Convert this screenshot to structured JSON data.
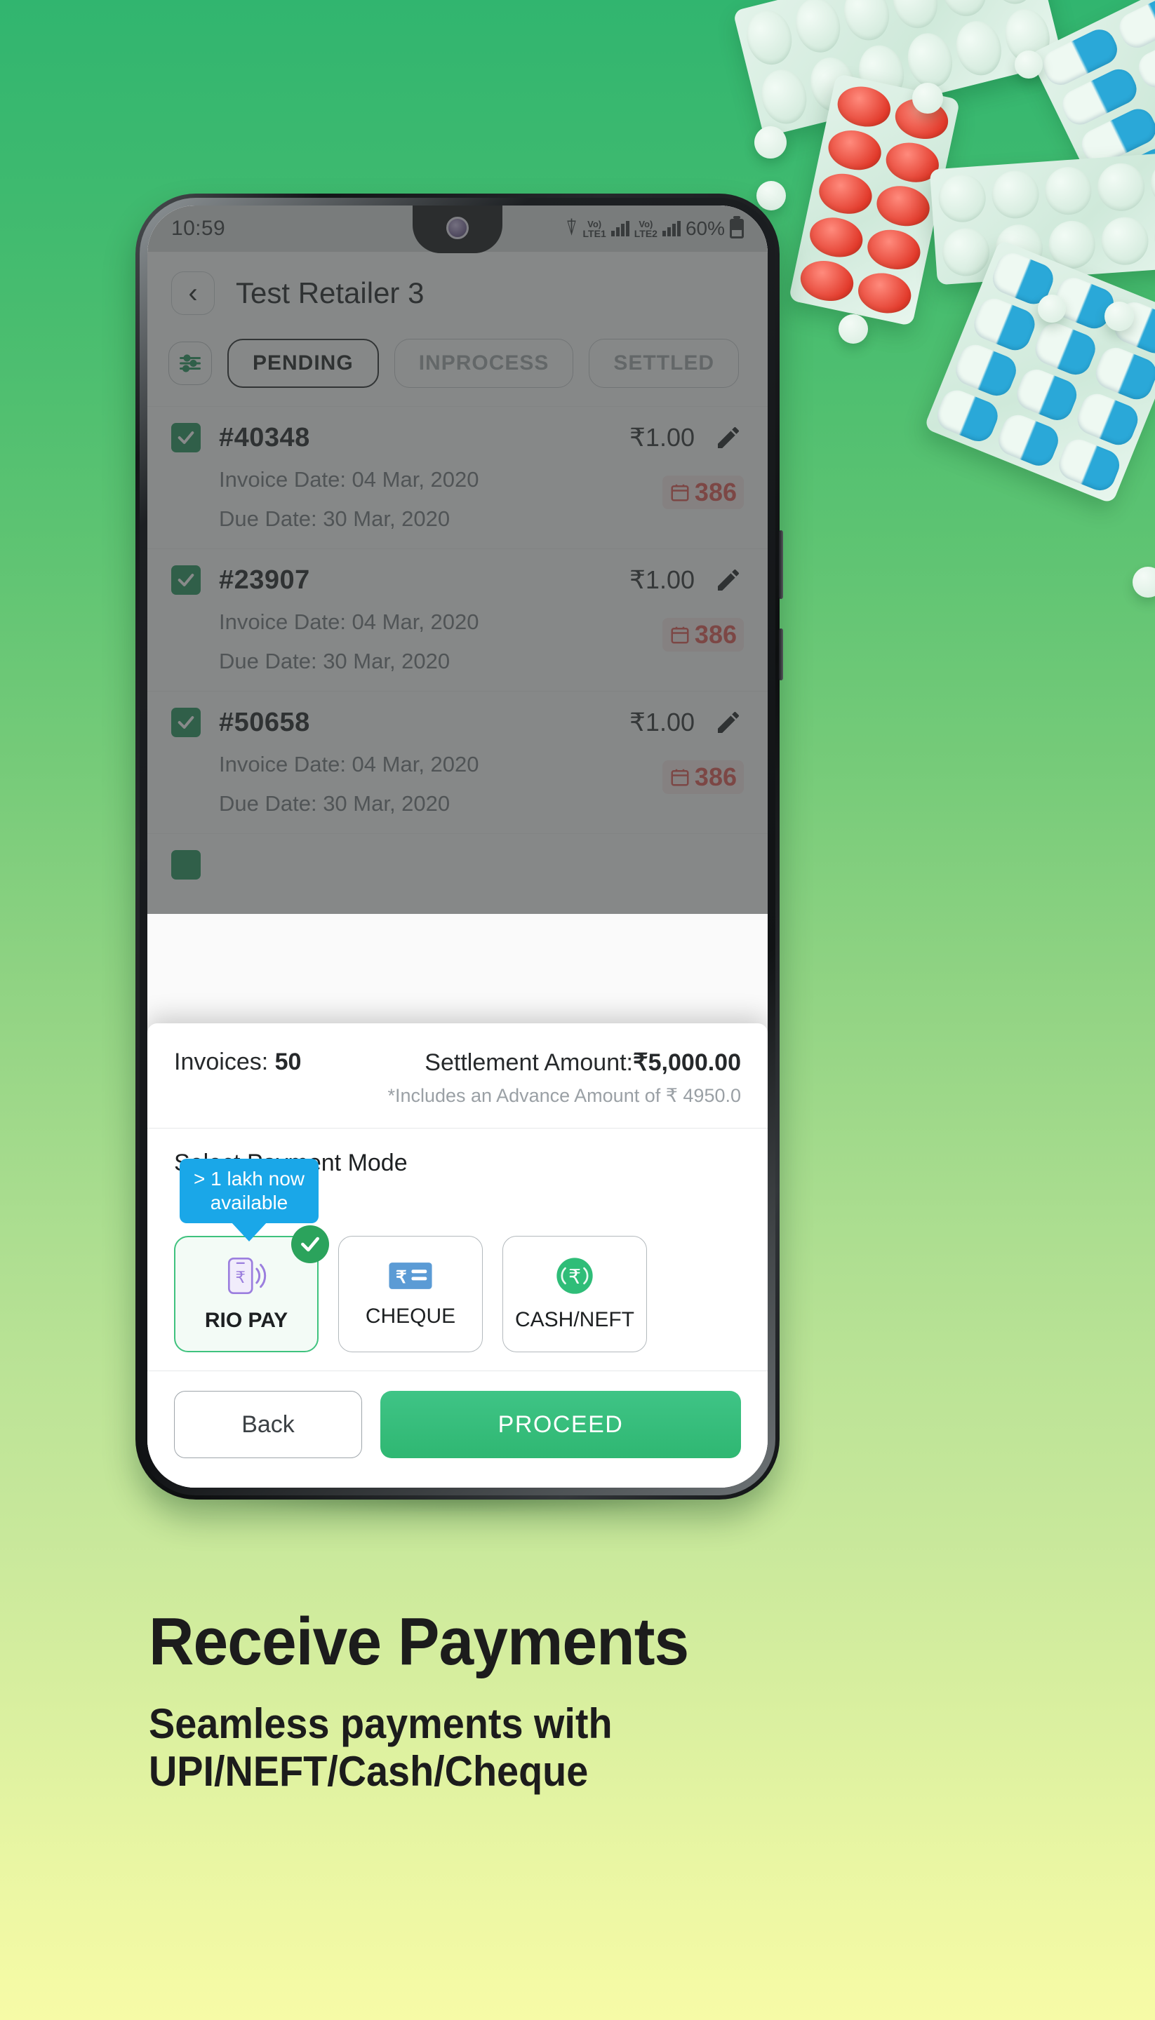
{
  "background": {
    "gradient_top": "#31b56f",
    "gradient_bottom": "#f7fba6",
    "motif": "pill-blister-packs"
  },
  "phone": {
    "statusbar": {
      "time": "10:59",
      "wifi_icon": "wifi-icon",
      "sim1_label": "Vo)",
      "sim1_sub": "LTE1",
      "sim2_label": "Vo)",
      "sim2_sub": "LTE2",
      "battery_percent": "60%",
      "battery_icon": "battery-icon"
    },
    "appbar": {
      "back_icon": "chevron-left-icon",
      "title": "Test Retailer 3"
    },
    "tabs": {
      "filter_icon": "filter-sliders-icon",
      "items": [
        {
          "label": "PENDING",
          "active": true
        },
        {
          "label": "INPROCESS",
          "active": false
        },
        {
          "label": "SETTLED",
          "active": false
        }
      ]
    },
    "invoices": [
      {
        "id": "#40348",
        "amount": "₹1.00",
        "invoice_date": "Invoice Date: 04 Mar, 2020",
        "due_date": "Due Date: 30 Mar, 2020",
        "days_overdue": "386",
        "selected": true
      },
      {
        "id": "#23907",
        "amount": "₹1.00",
        "invoice_date": "Invoice Date: 04 Mar, 2020",
        "due_date": "Due Date: 30 Mar, 2020",
        "days_overdue": "386",
        "selected": true
      },
      {
        "id": "#50658",
        "amount": "₹1.00",
        "invoice_date": "Invoice Date: 04 Mar, 2020",
        "due_date": "Due Date: 30 Mar, 2020",
        "days_overdue": "386",
        "selected": true
      }
    ],
    "sheet": {
      "invoices_label": "Invoices:",
      "invoices_count": "50",
      "settlement_label": "Settlement Amount:",
      "settlement_amount": "₹5,000.00",
      "advance_note": "*Includes an Advance Amount of ₹ 4950.0",
      "payment_mode_title": "Select Payment Mode",
      "tooltip": "> 1 lakh now available",
      "payment_modes": [
        {
          "label": "RIO PAY",
          "icon": "mobile-rupee-contactless-icon",
          "selected": true
        },
        {
          "label": "CHEQUE",
          "icon": "cheque-rupee-icon",
          "selected": false
        },
        {
          "label": "CASH/NEFT",
          "icon": "rupee-coin-icon",
          "selected": false
        }
      ],
      "back_button": "Back",
      "proceed_button": "PROCEED"
    }
  },
  "marketing": {
    "headline": "Receive Payments",
    "subhead_line1": "Seamless payments with",
    "subhead_line2": "UPI/NEFT/Cash/Cheque"
  },
  "colors": {
    "brand_green": "#2fb772",
    "selected_green": "#3fc27e",
    "overdue_red": "#e0504b",
    "tooltip_blue": "#1aa7e8"
  }
}
